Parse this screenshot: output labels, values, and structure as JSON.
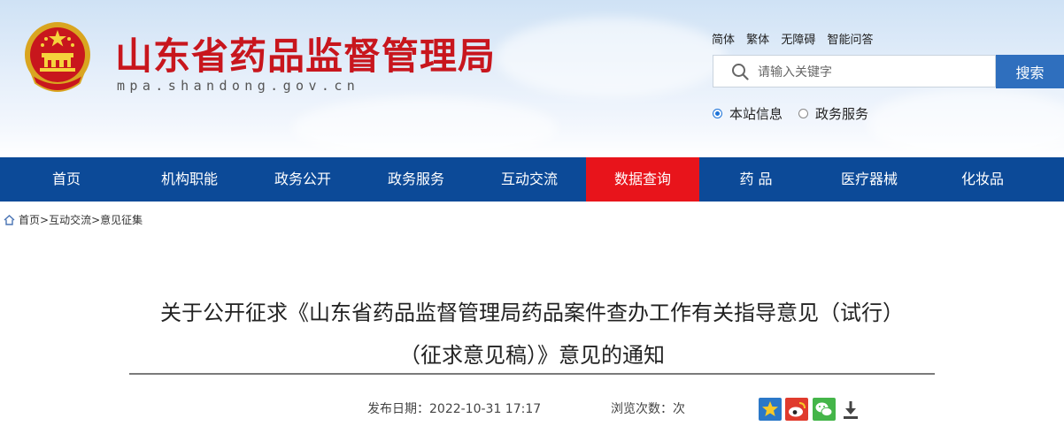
{
  "site": {
    "title": "山东省药品监督管理局",
    "domain": "mpa.shandong.gov.cn"
  },
  "top_links": [
    "简体",
    "繁体",
    "无障碍",
    "智能问答"
  ],
  "search": {
    "placeholder": "请输入关键字",
    "button_label": "搜索",
    "scopes": [
      {
        "label": "本站信息",
        "checked": true
      },
      {
        "label": "政务服务",
        "checked": false
      }
    ]
  },
  "nav": {
    "items": [
      "首页",
      "机构职能",
      "政务公开",
      "政务服务",
      "互动交流",
      "数据查询",
      "药 品",
      "医疗器械",
      "化妆品"
    ],
    "active_index": 5
  },
  "breadcrumb": [
    "首页",
    "互动交流",
    "意见征集"
  ],
  "article": {
    "title_line1": "关于公开征求《山东省药品监督管理局药品案件查办工作有关指导意见（试行）",
    "title_line2": "（征求意见稿）》意见的通知",
    "publish_label": "发布日期：",
    "publish_date": "2022-10-31 17:17",
    "views_label": "浏览次数：",
    "views_suffix": "次"
  },
  "colors": {
    "brand_red": "#c8161d",
    "nav_blue": "#0c4a98",
    "nav_active": "#e8141b",
    "search_button": "#2f6fbe"
  },
  "icons": [
    "emblem-icon",
    "search-icon",
    "home-icon",
    "favorite-icon",
    "weibo-icon",
    "wechat-icon",
    "download-icon"
  ]
}
